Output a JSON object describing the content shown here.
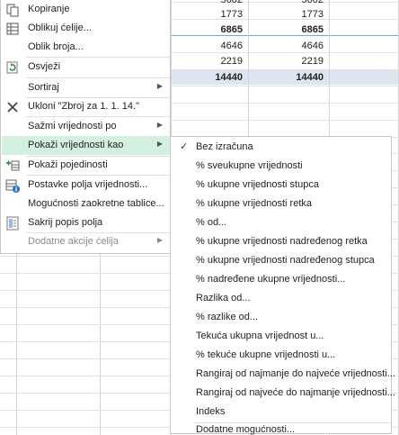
{
  "sheet": {
    "rows": [
      {
        "c1": "5602",
        "c2": "5602",
        "bold": false
      },
      {
        "c1": "1773",
        "c2": "1773",
        "bold": false
      },
      {
        "c1": "6865",
        "c2": "6865",
        "bold": true
      },
      {
        "c1": "4646",
        "c2": "4646",
        "bold": false
      },
      {
        "c1": "2219",
        "c2": "2219",
        "bold": false
      },
      {
        "c1": "14440",
        "c2": "14440",
        "bold": true
      }
    ]
  },
  "context_menu": {
    "items": [
      {
        "label": "Kopiranje",
        "icon": "copy-icon"
      },
      {
        "label": "Oblikuj ćelije...",
        "icon": "format-cells-icon"
      },
      {
        "label": "Oblik broja...",
        "icon": ""
      },
      {
        "label": "Osvježi",
        "icon": "refresh-icon"
      },
      {
        "label": "Sortiraj",
        "icon": "",
        "submenu": true
      },
      {
        "label": "Ukloni \"Zbroj za 1. 1. 14.\"",
        "icon": "remove-icon"
      },
      {
        "label": "Sažmi vrijednosti po",
        "icon": "",
        "submenu": true
      },
      {
        "label": "Pokaži vrijednosti kao",
        "icon": "",
        "submenu": true,
        "highlighted": true
      },
      {
        "label": "Pokaži pojedinosti",
        "icon": "show-details-icon"
      },
      {
        "label": "Postavke polja vrijednosti...",
        "icon": "field-settings-icon"
      },
      {
        "label": "Mogućnosti zaokretne tablice...",
        "icon": ""
      },
      {
        "label": "Sakrij popis polja",
        "icon": "field-list-icon"
      },
      {
        "label": "Dodatne akcije ćelija",
        "icon": "",
        "submenu": true,
        "disabled": true
      }
    ],
    "submenu_glyph": "▶"
  },
  "show_values_submenu": {
    "checked_glyph": "✓",
    "items": [
      {
        "label": "Bez izračuna",
        "checked": true
      },
      {
        "label": "% sveukupne vrijednosti"
      },
      {
        "label": "% ukupne vrijednosti stupca"
      },
      {
        "label": "% ukupne vrijednosti retka"
      },
      {
        "label": "% od..."
      },
      {
        "label": "% ukupne vrijednosti nadređenog retka"
      },
      {
        "label": "% ukupne vrijednosti nadređenog stupca"
      },
      {
        "label": "% nadređene ukupne vrijednosti..."
      },
      {
        "label": "Razlika od..."
      },
      {
        "label": "% razlike od..."
      },
      {
        "label": "Tekuća ukupna vrijednost u..."
      },
      {
        "label": "% tekuće ukupne vrijednosti u..."
      },
      {
        "label": "Rangiraj od najmanje do najveće vrijednosti..."
      },
      {
        "label": "Rangiraj od najveće do najmanje vrijednosti..."
      },
      {
        "label": "Indeks"
      },
      {
        "label": "Dodatne mogućnosti..."
      }
    ]
  }
}
